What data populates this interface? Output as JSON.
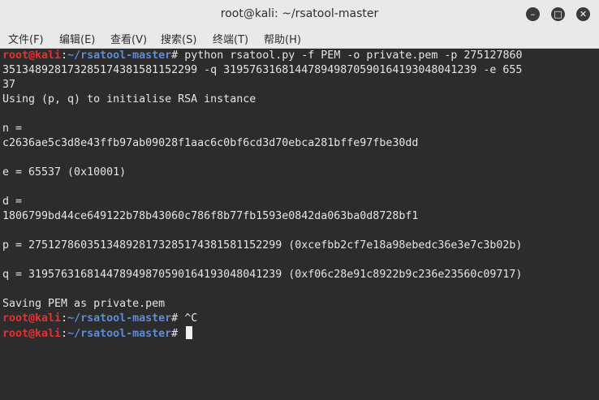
{
  "window": {
    "title": "root@kali: ~/rsatool-master",
    "minimize_glyph": "–",
    "maximize_glyph": "□",
    "close_glyph": "✕"
  },
  "menu": {
    "items": [
      "文件(F)",
      "编辑(E)",
      "查看(V)",
      "搜索(S)",
      "终端(T)",
      "帮助(H)"
    ]
  },
  "prompt": {
    "user_host": "root@kali",
    "separator": ":",
    "path": "~/rsatool-master",
    "symbol": "#"
  },
  "terminal": {
    "command1_line1": " python rsatool.py -f PEM -o private.pem -p 275127860",
    "command1_line2": "351348928173285174381581152299 -q 319576316814478949870590164193048041239 -e 655",
    "command1_line3": "37",
    "out_using": "Using (p, q) to initialise RSA instance",
    "out_n_label": "n =",
    "out_n_value": "c2636ae5c3d8e43ffb97ab09028f1aac6c0bf6cd3d70ebca281bffe97fbe30dd",
    "out_e": "e = 65537 (0x10001)",
    "out_d_label": "d =",
    "out_d_value": "1806799bd44ce649122b78b43060c786f8b77fb1593e0842da063ba0d8728bf1",
    "out_p": "p = 275127860351348928173285174381581152299 (0xcefbb2cf7e18a98ebedc36e3e7c3b02b)",
    "out_q": "q = 319576316814478949870590164193048041239 (0xf06c28e91c8922b9c236e23560c09717)",
    "out_saving": "Saving PEM as private.pem",
    "command2": " ^C",
    "command3": " "
  },
  "colors": {
    "prompt_user": "#e73131",
    "prompt_path": "#5c8dd6",
    "terminal_bg": "#2c2c2c",
    "terminal_fg": "#e5e5e5"
  }
}
